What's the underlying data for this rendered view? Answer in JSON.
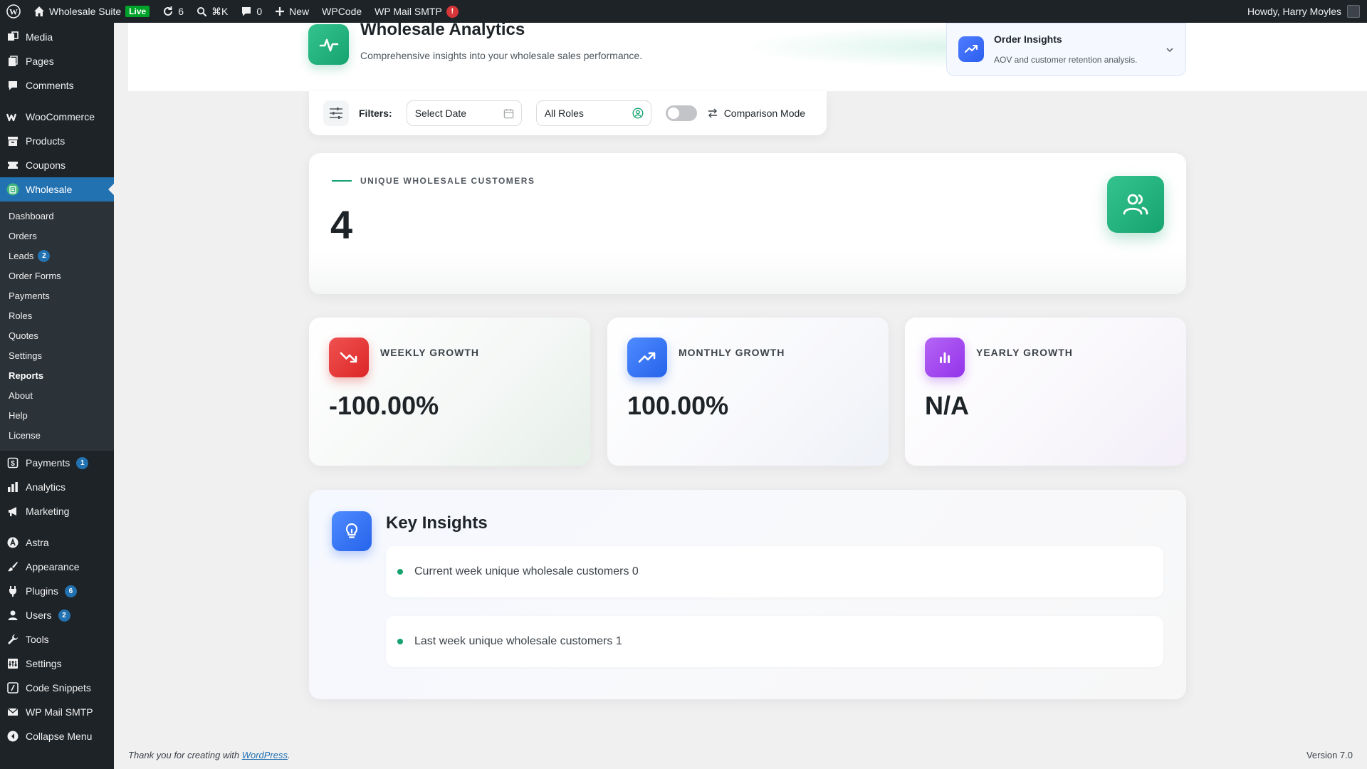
{
  "adminbar": {
    "site_name": "Wholesale Suite",
    "live_label": "Live",
    "updates_count": "6",
    "search_shortcut": "⌘K",
    "comments_count": "0",
    "new_label": "New",
    "wpcode_label": "WPCode",
    "smtp_label": "WP Mail SMTP",
    "smtp_alert": "!",
    "greeting": "Howdy, Harry Moyles"
  },
  "sidebar": {
    "top_items": [
      {
        "label": "Media",
        "icon": "media-icon"
      },
      {
        "label": "Pages",
        "icon": "pages-icon"
      },
      {
        "label": "Comments",
        "icon": "comments-icon"
      }
    ],
    "store_items": [
      {
        "label": "WooCommerce",
        "icon": "woocommerce-icon"
      },
      {
        "label": "Products",
        "icon": "products-icon"
      },
      {
        "label": "Coupons",
        "icon": "coupons-icon"
      },
      {
        "label": "Wholesale",
        "icon": "wholesale-icon"
      }
    ],
    "submenu": [
      {
        "label": "Dashboard"
      },
      {
        "label": "Orders"
      },
      {
        "label": "Leads",
        "count": "2"
      },
      {
        "label": "Order Forms"
      },
      {
        "label": "Payments"
      },
      {
        "label": "Roles"
      },
      {
        "label": "Quotes"
      },
      {
        "label": "Settings"
      },
      {
        "label": "Reports"
      },
      {
        "label": "About"
      },
      {
        "label": "Help"
      },
      {
        "label": "License"
      }
    ],
    "payments": {
      "label": "Payments",
      "count": "1"
    },
    "analytics": {
      "label": "Analytics"
    },
    "marketing": {
      "label": "Marketing"
    },
    "astra": {
      "label": "Astra"
    },
    "appearance": {
      "label": "Appearance"
    },
    "plugins": {
      "label": "Plugins",
      "count": "6"
    },
    "users": {
      "label": "Users",
      "count": "2"
    },
    "tools": {
      "label": "Tools"
    },
    "settings": {
      "label": "Settings"
    },
    "code_snippets": {
      "label": "Code Snippets"
    },
    "wp_mail_smtp": {
      "label": "WP Mail SMTP"
    },
    "collapse": {
      "label": "Collapse Menu"
    }
  },
  "header": {
    "title": "Wholesale Analytics",
    "subtitle": "Comprehensive insights into your wholesale sales performance.",
    "insights_dropdown": {
      "title": "Order Insights",
      "subtitle": "AOV and customer retention analysis."
    }
  },
  "filters": {
    "label": "Filters:",
    "date_placeholder": "Select Date",
    "role_value": "All Roles",
    "comparison_label": "Comparison Mode"
  },
  "customers_card": {
    "label": "UNIQUE WHOLESALE CUSTOMERS",
    "value": "4"
  },
  "growth": [
    {
      "title": "WEEKLY GROWTH",
      "value": "-100.00%",
      "color": "#ef4444"
    },
    {
      "title": "MONTHLY GROWTH",
      "value": "100.00%",
      "color": "#3b82f6"
    },
    {
      "title": "YEARLY GROWTH",
      "value": "N/A",
      "color": "#a855f7"
    }
  ],
  "insights": {
    "title": "Key Insights",
    "items": [
      {
        "text": "Current week unique wholesale customers 0"
      },
      {
        "text": "Last week unique wholesale customers 1"
      }
    ]
  },
  "footer": {
    "thanks_prefix": "Thank you for creating with",
    "wordpress_link": "WordPress",
    "thanks_suffix": ".",
    "version": "Version 7.0"
  },
  "colors": {
    "brand_green": "#16a36f",
    "wp_blue": "#2271b1",
    "admin_dark": "#1d2327"
  }
}
